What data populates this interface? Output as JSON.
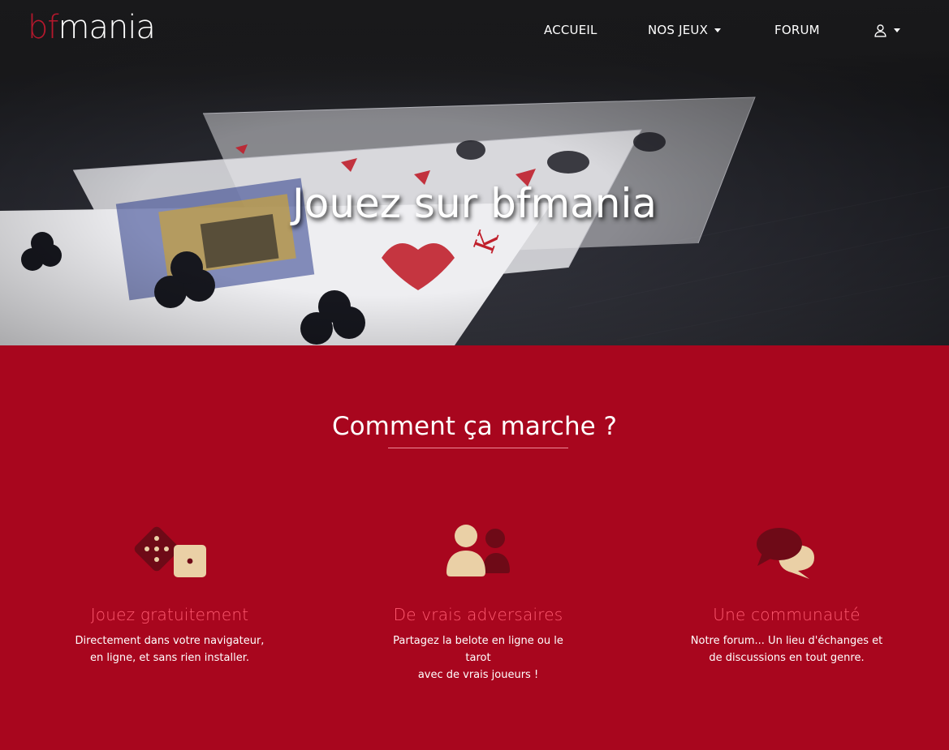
{
  "brand": {
    "logo_prefix": "bf",
    "logo_suffix": "mania"
  },
  "nav": {
    "items": [
      {
        "label": "ACCUEIL"
      },
      {
        "label": "NOS JEUX"
      },
      {
        "label": "FORUM"
      }
    ],
    "user_menu_icon": "user-icon"
  },
  "hero": {
    "title": "Jouez sur bfmania"
  },
  "how_it_works": {
    "title": "Comment ça marche ?",
    "features": [
      {
        "icon": "dice-icon",
        "title": "Jouez gratuitement",
        "line1": "Directement dans votre navigateur,",
        "line2": "en ligne, et sans rien installer."
      },
      {
        "icon": "users-icon",
        "title": "De vrais adversaires",
        "line1": "Partagez la belote en ligne ou le tarot",
        "line2": "avec de vrais joueurs !"
      },
      {
        "icon": "comments-icon",
        "title": "Une communauté",
        "line1": "Notre forum... Un lieu d'échanges et",
        "line2": "de discussions en tout genre."
      }
    ]
  },
  "colors": {
    "brand_red": "#a8061e",
    "feature_title": "#ff5a70",
    "icon_dark": "#6e0a17",
    "icon_light": "#ead0a6"
  }
}
